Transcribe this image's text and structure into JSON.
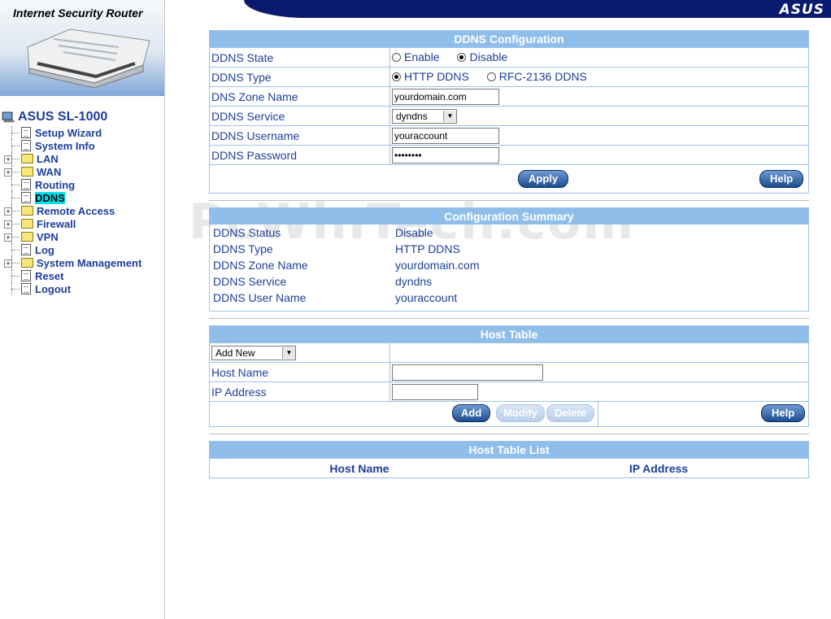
{
  "banner": {
    "brand": "ASUS"
  },
  "sidebar": {
    "router_title": "Internet Security Router",
    "root_label": "ASUS SL-1000",
    "items": [
      {
        "label": "Setup Wizard",
        "type": "doc",
        "expand": false
      },
      {
        "label": "System Info",
        "type": "doc",
        "expand": false
      },
      {
        "label": "LAN",
        "type": "folder",
        "expand": true
      },
      {
        "label": "WAN",
        "type": "folder",
        "expand": true
      },
      {
        "label": "Routing",
        "type": "doc",
        "expand": false
      },
      {
        "label": "DDNS",
        "type": "doc",
        "expand": false,
        "active": true
      },
      {
        "label": "Remote Access",
        "type": "folder",
        "expand": true
      },
      {
        "label": "Firewall",
        "type": "folder",
        "expand": true
      },
      {
        "label": "VPN",
        "type": "folder",
        "expand": true
      },
      {
        "label": "Log",
        "type": "doc",
        "expand": false
      },
      {
        "label": "System Management",
        "type": "folder",
        "expand": true
      },
      {
        "label": "Reset",
        "type": "doc",
        "expand": false
      },
      {
        "label": "Logout",
        "type": "doc",
        "expand": false
      }
    ]
  },
  "ddns_config": {
    "title": "DDNS Configuration",
    "state_label": "DDNS State",
    "state_enable": "Enable",
    "state_disable": "Disable",
    "type_label": "DDNS Type",
    "type_http": "HTTP DDNS",
    "type_rfc": "RFC-2136 DDNS",
    "zone_label": "DNS Zone Name",
    "zone_value": "yourdomain.com",
    "service_label": "DDNS Service",
    "service_value": "dyndns",
    "username_label": "DDNS Username",
    "username_value": "youraccount",
    "password_label": "DDNS Password",
    "password_value": "********",
    "apply": "Apply",
    "help": "Help"
  },
  "summary": {
    "title": "Configuration Summary",
    "rows": [
      {
        "label": "DDNS Status",
        "value": "Disable"
      },
      {
        "label": "DDNS Type",
        "value": "HTTP DDNS"
      },
      {
        "label": "DDNS Zone Name",
        "value": "yourdomain.com"
      },
      {
        "label": "DDNS Service",
        "value": "dyndns"
      },
      {
        "label": "DDNS User Name",
        "value": "youraccount"
      }
    ]
  },
  "host_table": {
    "title": "Host Table",
    "select_value": "Add New",
    "host_label": "Host Name",
    "ip_label": "IP Address",
    "add": "Add",
    "modify": "Modify",
    "delete": "Delete",
    "help": "Help"
  },
  "host_list": {
    "title": "Host Table List",
    "col_host": "Host Name",
    "col_ip": "IP Address"
  },
  "watermark": "PcWinTech.com"
}
